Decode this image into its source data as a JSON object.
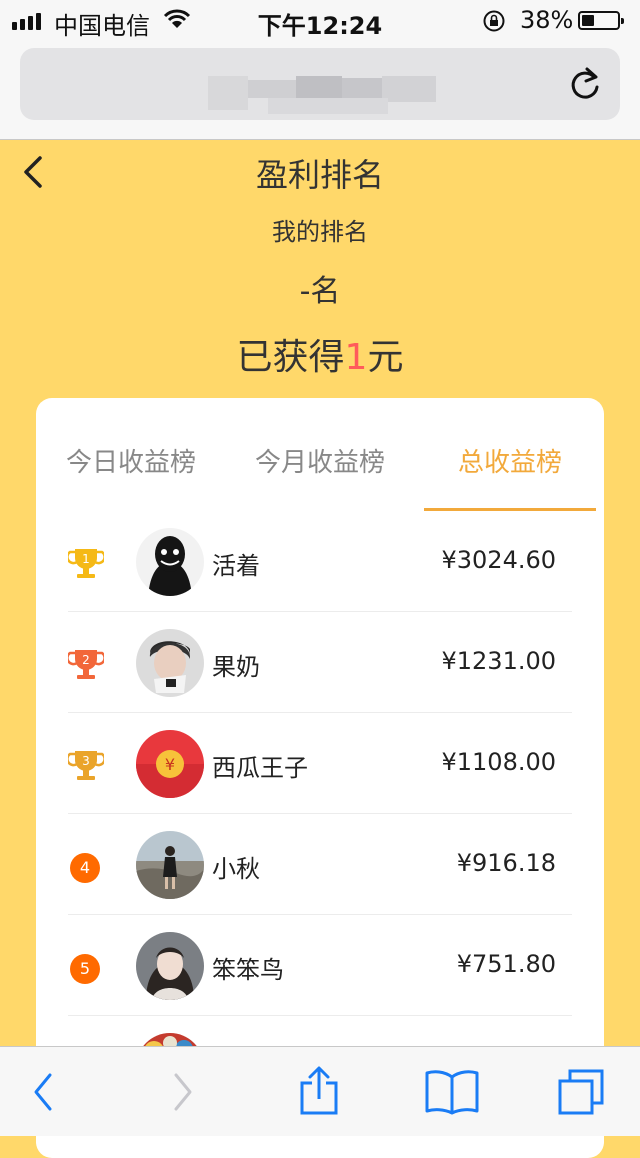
{
  "status_bar": {
    "carrier": "中国电信",
    "time": "下午12:24",
    "battery": "38%",
    "battery_level": 0.38
  },
  "browser": {
    "reload_icon": "reload-icon"
  },
  "header": {
    "title": "盈利排名",
    "my_rank_label": "我的排名",
    "my_rank_value": "-名",
    "earned_prefix": "已获得",
    "earned_amount": "1",
    "earned_suffix": "元"
  },
  "tabs": [
    {
      "label": "今日收益榜",
      "active": false
    },
    {
      "label": "今月收益榜",
      "active": false
    },
    {
      "label": "总收益榜",
      "active": true
    }
  ],
  "leaderboard": [
    {
      "rank": "1",
      "name": "活着",
      "amount": "¥3024.60"
    },
    {
      "rank": "2",
      "name": "果奶",
      "amount": "¥1231.00"
    },
    {
      "rank": "3",
      "name": "西瓜王子",
      "amount": "¥1108.00"
    },
    {
      "rank": "4",
      "name": "小秋",
      "amount": "¥916.18"
    },
    {
      "rank": "5",
      "name": "笨笨鸟",
      "amount": "¥751.80"
    }
  ],
  "colors": {
    "background": "#ffd86a",
    "accent": "#f2a93b",
    "highlight": "#ff5b5b",
    "rank_badge": "#ff6a00",
    "ios_blue": "#1a7cf5"
  }
}
